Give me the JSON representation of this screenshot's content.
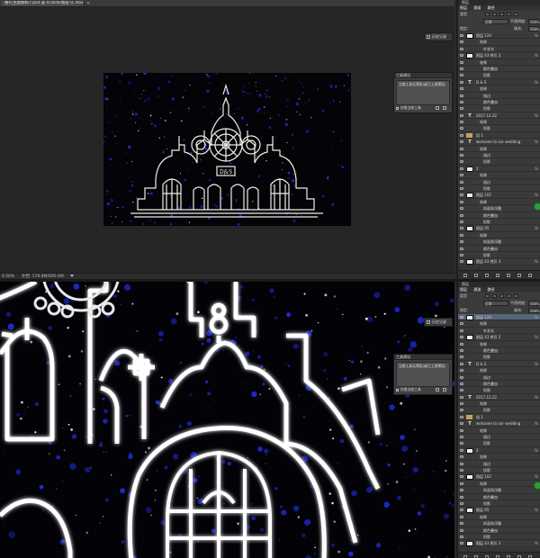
{
  "document": {
    "tab_title": "婚礼主题图标7.psd @ 9.56%(图层 0, RGB/8)",
    "status_zoom": "9.56%",
    "status_doc": "文档: 178.8M/695.6M"
  },
  "history_panel": {
    "label": "历史记录"
  },
  "tool_presets": {
    "title": "工具预设",
    "body_lines": [
      "当前工具无预设(或已工具预设)"
    ],
    "current_tool_only_label": "仅限当前工具"
  },
  "layers_panel": {
    "header": "图层",
    "tabs": [
      "图层",
      "通道",
      "路径"
    ],
    "filter_label": "类型",
    "blend_mode": "正常",
    "opacity_label": "不透明度:",
    "opacity_value": "100%",
    "lock_label": "锁定:",
    "fill_label": "填充:",
    "fill_value": "100%",
    "rows": [
      {
        "type": "layer",
        "name": "图层 124",
        "fx": true
      },
      {
        "type": "effect-header",
        "name": "效果"
      },
      {
        "type": "effect",
        "name": "外发光"
      },
      {
        "type": "layer",
        "name": "图层 43 拷贝 2",
        "fx": true
      },
      {
        "type": "effect-header",
        "name": "效果"
      },
      {
        "type": "effect",
        "name": "颜色叠加"
      },
      {
        "type": "effect",
        "name": "投影"
      },
      {
        "type": "text",
        "name": "D & S",
        "fx": true
      },
      {
        "type": "effect-header",
        "name": "效果"
      },
      {
        "type": "effect",
        "name": "描边"
      },
      {
        "type": "effect",
        "name": "颜色叠加"
      },
      {
        "type": "effect",
        "name": "投影"
      },
      {
        "type": "text",
        "name": "2017.12.22",
        "fx": true
      },
      {
        "type": "effect-header",
        "name": "效果"
      },
      {
        "type": "effect",
        "name": "投影"
      },
      {
        "type": "group",
        "name": "组 1"
      },
      {
        "type": "text",
        "name": "welcome to our wedding",
        "fx": true
      },
      {
        "type": "effect-header",
        "name": "效果"
      },
      {
        "type": "effect",
        "name": "描边"
      },
      {
        "type": "effect",
        "name": "投影"
      },
      {
        "type": "layer",
        "name": "2",
        "fx": true
      },
      {
        "type": "effect-header",
        "name": "效果"
      },
      {
        "type": "effect",
        "name": "描边"
      },
      {
        "type": "effect",
        "name": "投影"
      },
      {
        "type": "layer",
        "name": "图层 102",
        "fx": true
      },
      {
        "type": "effect-header",
        "name": "效果"
      },
      {
        "type": "effect",
        "name": "斜面和浮雕"
      },
      {
        "type": "effect",
        "name": "颜色叠加"
      },
      {
        "type": "effect",
        "name": "投影"
      },
      {
        "type": "layer",
        "name": "图层 95",
        "fx": true
      },
      {
        "type": "effect-header",
        "name": "效果"
      },
      {
        "type": "effect",
        "name": "斜面和浮雕"
      },
      {
        "type": "effect",
        "name": "颜色叠加"
      },
      {
        "type": "effect",
        "name": "投影"
      },
      {
        "type": "layer",
        "name": "图层 43 拷贝 3",
        "fx": true
      }
    ]
  },
  "colors": {
    "selection": "#55657a",
    "green_button": "#2e9e3a",
    "canvas_bg": "#030308"
  }
}
